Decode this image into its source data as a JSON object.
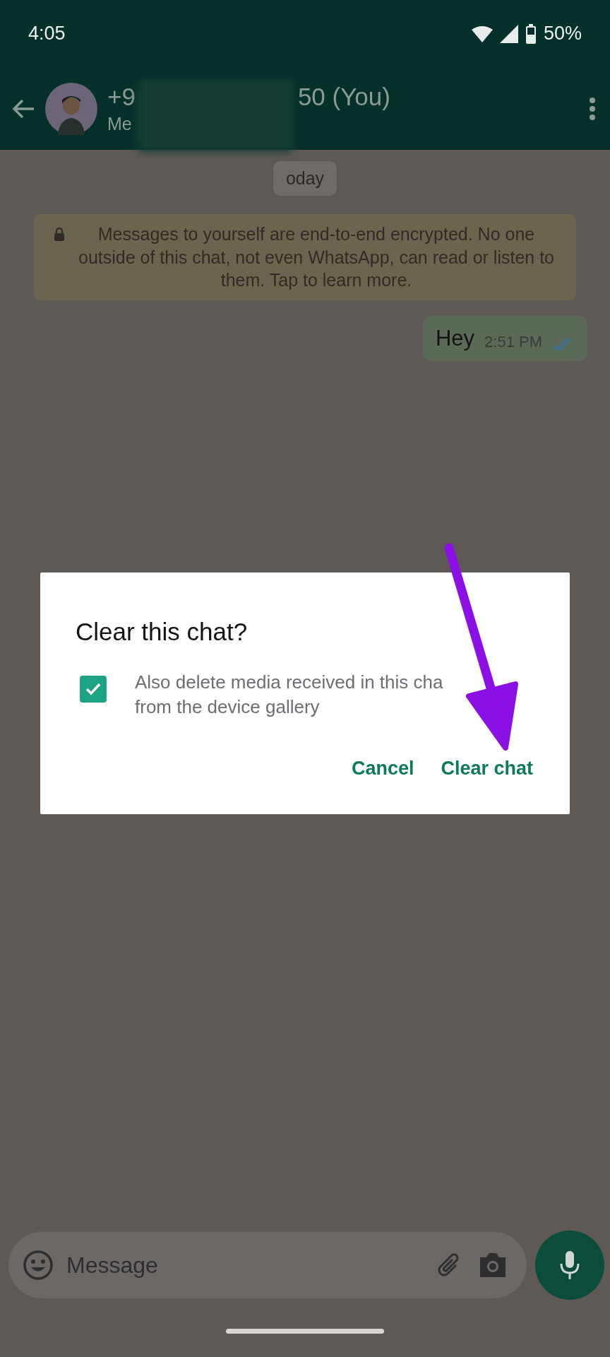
{
  "status_bar": {
    "time": "4:05",
    "battery": "50%"
  },
  "header": {
    "title_start": "+9",
    "title_end": "50 (You)",
    "subtitle": "Me"
  },
  "chat": {
    "date_chip": "oday",
    "notice": "Messages to yourself are end-to-end encrypted. No one outside of this chat, not even WhatsApp, can read or listen to them. Tap to learn more.",
    "messages": [
      {
        "text": "Hey",
        "time": "2:51 PM",
        "read": true
      }
    ]
  },
  "dialog": {
    "title": "Clear this chat?",
    "checkbox": {
      "checked": true,
      "lines": [
        "Also delete media received in this cha",
        "from the device gallery"
      ]
    },
    "buttons": [
      {
        "label": "Cancel"
      },
      {
        "label": "Clear chat"
      }
    ]
  },
  "composer": {
    "placeholder": "Message"
  }
}
